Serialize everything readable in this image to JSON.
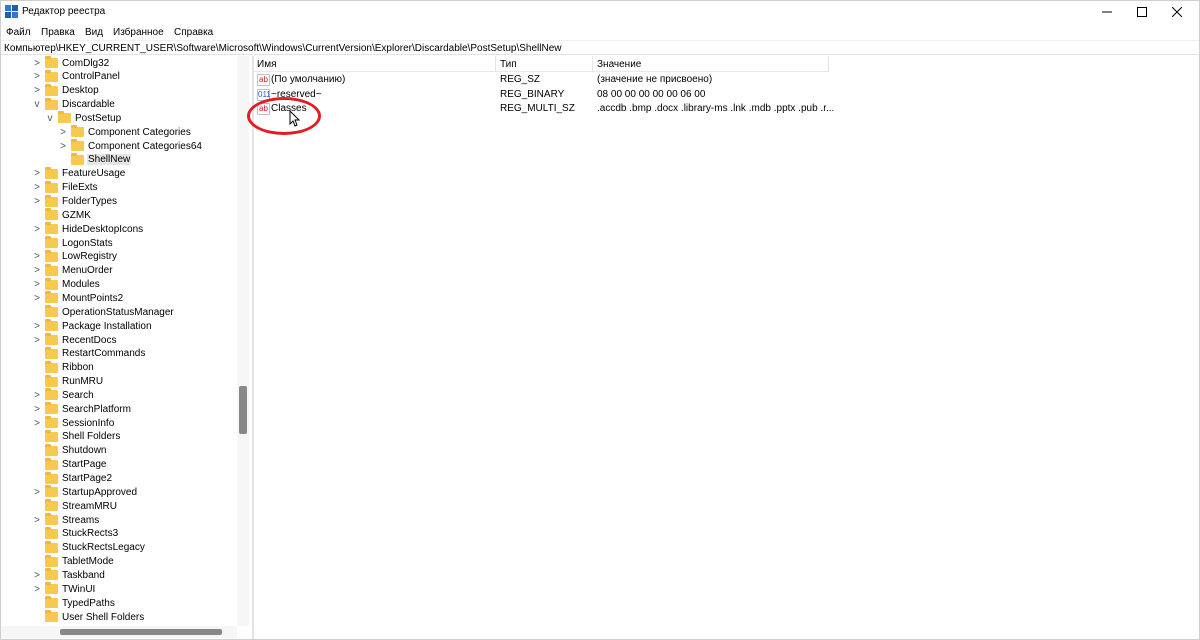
{
  "window": {
    "title": "Редактор реестра",
    "icon": "regedit-icon",
    "controls": {
      "minimize": "—",
      "maximize": "☐",
      "close": "✕"
    }
  },
  "menu": [
    "Файл",
    "Правка",
    "Вид",
    "Избранное",
    "Справка"
  ],
  "address": "Компьютер\\HKEY_CURRENT_USER\\Software\\Microsoft\\Windows\\CurrentVersion\\Explorer\\Discardable\\PostSetup\\ShellNew",
  "tree": {
    "items": [
      {
        "label": "ComDlg32",
        "expander": ">"
      },
      {
        "label": "ControlPanel",
        "expander": ">"
      },
      {
        "label": "Desktop",
        "expander": ">"
      },
      {
        "label": "Discardable",
        "expander": "v"
      },
      {
        "label": "PostSetup",
        "expander": "v"
      },
      {
        "label": "Component Categories",
        "expander": ">"
      },
      {
        "label": "Component Categories64",
        "expander": ">"
      },
      {
        "label": "ShellNew",
        "expander": "",
        "selected": true
      },
      {
        "label": "FeatureUsage",
        "expander": ">"
      },
      {
        "label": "FileExts",
        "expander": ">"
      },
      {
        "label": "FolderTypes",
        "expander": ">"
      },
      {
        "label": "GZMK",
        "expander": ""
      },
      {
        "label": "HideDesktopIcons",
        "expander": ">"
      },
      {
        "label": "LogonStats",
        "expander": ""
      },
      {
        "label": "LowRegistry",
        "expander": ">"
      },
      {
        "label": "MenuOrder",
        "expander": ">"
      },
      {
        "label": "Modules",
        "expander": ">"
      },
      {
        "label": "MountPoints2",
        "expander": ">"
      },
      {
        "label": "OperationStatusManager",
        "expander": ""
      },
      {
        "label": "Package Installation",
        "expander": ">"
      },
      {
        "label": "RecentDocs",
        "expander": ">"
      },
      {
        "label": "RestartCommands",
        "expander": ""
      },
      {
        "label": "Ribbon",
        "expander": ""
      },
      {
        "label": "RunMRU",
        "expander": ""
      },
      {
        "label": "Search",
        "expander": ">"
      },
      {
        "label": "SearchPlatform",
        "expander": ">"
      },
      {
        "label": "SessionInfo",
        "expander": ">"
      },
      {
        "label": "Shell Folders",
        "expander": ""
      },
      {
        "label": "Shutdown",
        "expander": ""
      },
      {
        "label": "StartPage",
        "expander": ""
      },
      {
        "label": "StartPage2",
        "expander": ""
      },
      {
        "label": "StartupApproved",
        "expander": ">"
      },
      {
        "label": "StreamMRU",
        "expander": ""
      },
      {
        "label": "Streams",
        "expander": ">"
      },
      {
        "label": "StuckRects3",
        "expander": ""
      },
      {
        "label": "StuckRectsLegacy",
        "expander": ""
      },
      {
        "label": "TabletMode",
        "expander": ""
      },
      {
        "label": "Taskband",
        "expander": ">"
      },
      {
        "label": "TWinUI",
        "expander": ">"
      },
      {
        "label": "TypedPaths",
        "expander": ""
      },
      {
        "label": "User Shell Folders",
        "expander": ""
      }
    ]
  },
  "list": {
    "columns": [
      "Имя",
      "Тип",
      "Значение"
    ],
    "rows": [
      {
        "icon": "sz",
        "icon_text": "ab",
        "name": "(По умолчанию)",
        "type": "REG_SZ",
        "value": "(значение не присвоено)"
      },
      {
        "icon": "bin",
        "icon_text": "011",
        "name": "~reserved~",
        "type": "REG_BINARY",
        "value": "08 00 00 00 00 00 06 00"
      },
      {
        "icon": "sz",
        "icon_text": "ab",
        "name": "Classes",
        "type": "REG_MULTI_SZ",
        "value": ".accdb .bmp .docx .library-ms .lnk .mdb .pptx .pub .r..."
      }
    ]
  },
  "colors": {
    "highlight": "#e31b23",
    "folder": "#f7c94e",
    "selection": "#e5e5e5"
  }
}
